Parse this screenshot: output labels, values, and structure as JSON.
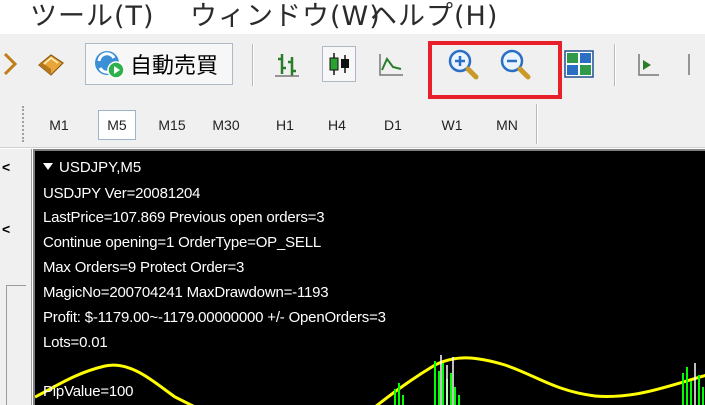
{
  "menu": {
    "items": [
      "ツール(T)",
      "ウィンドウ(W)",
      "ヘルプ(H)"
    ]
  },
  "toolbar": {
    "autotrade_label": "自動売買",
    "highlight_color": "#e8202a"
  },
  "timeframes": {
    "items": [
      "M1",
      "M5",
      "M15",
      "M30",
      "H1",
      "H4",
      "D1",
      "W1",
      "MN"
    ],
    "active": "M5"
  },
  "left_panel": {
    "tabs": [
      "<",
      "<"
    ]
  },
  "chart": {
    "symbol_title": "USDJPY,M5",
    "info_lines": [
      "USDJPY Ver=20081204",
      "LastPrice=107.869 Previous open orders=3",
      "Continue opening=1 OrderType=OP_SELL",
      "Max Orders=9 Protect Order=3",
      "MagicNo=200704241 MaxDrawdown=-1193",
      "Profit: $-1179.00~-1179.00000000 +/-  OpenOrders=3",
      "Lots=0.01",
      "PipValue=100"
    ],
    "line_color": "#ffff00",
    "bar_color": "#00ff00",
    "background": "#000000"
  }
}
